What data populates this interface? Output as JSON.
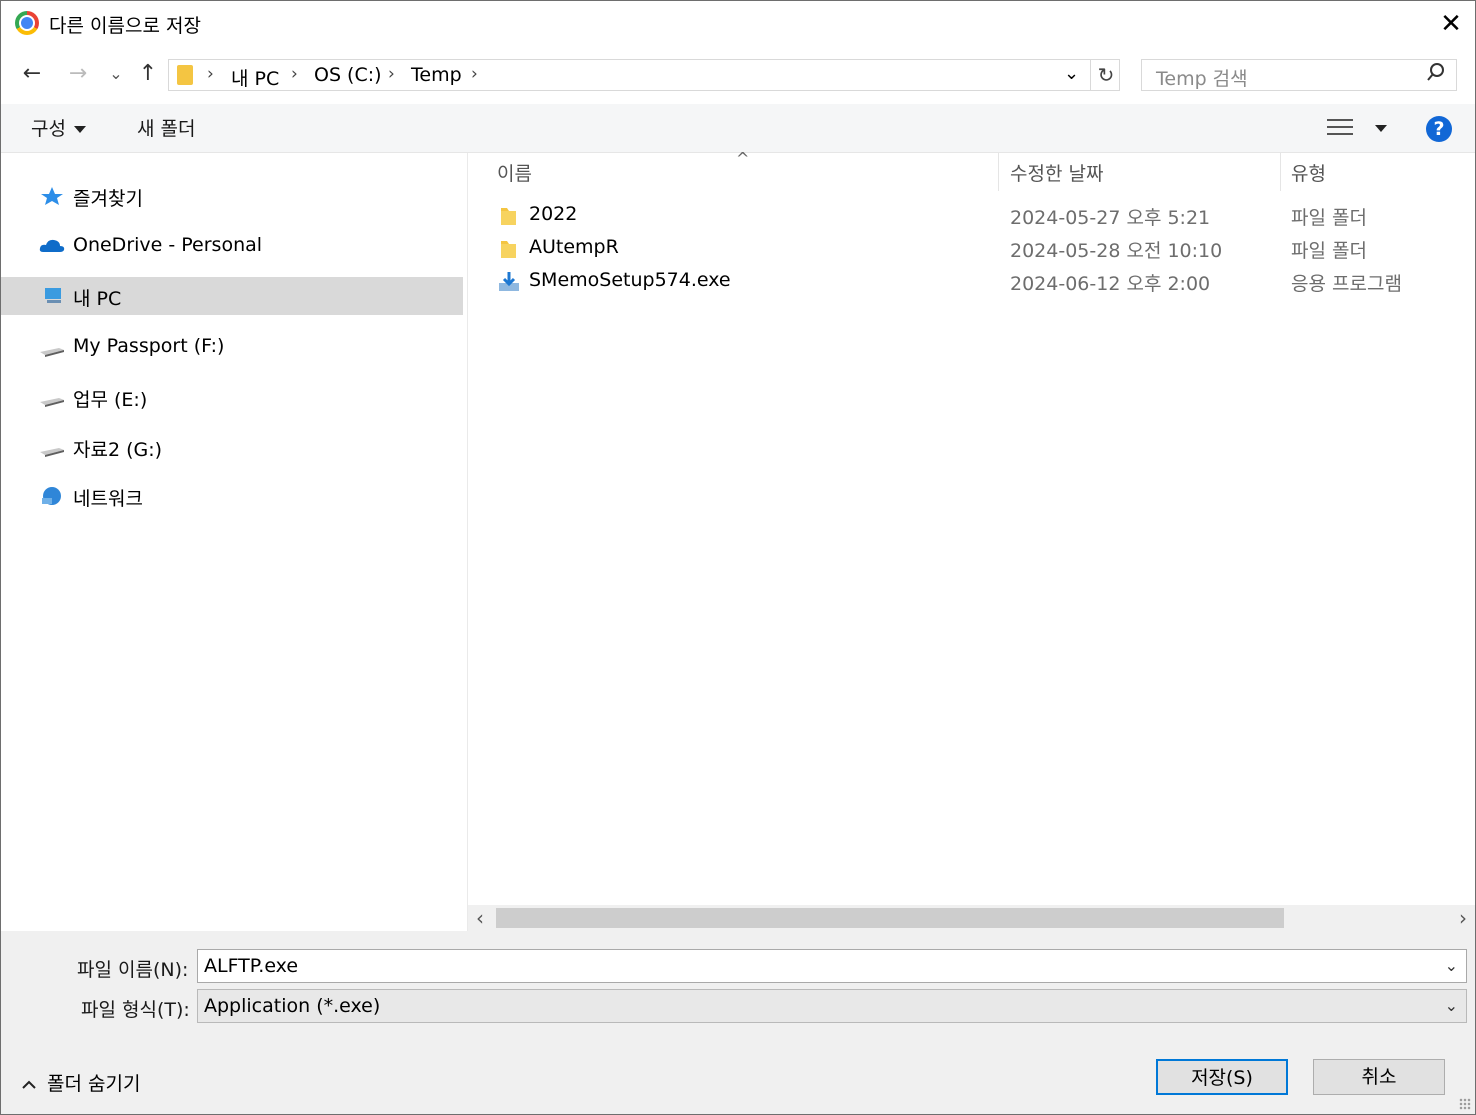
{
  "window": {
    "title": "다른 이름으로 저장",
    "close": "✕"
  },
  "nav": {
    "back": "←",
    "forward": "→",
    "recent": "⌄",
    "up": "↑",
    "breadcrumbs": [
      "내 PC",
      "OS (C:)",
      "Temp"
    ],
    "separator": "›",
    "dropdown": "⌄",
    "refresh": "↻",
    "search_placeholder": "Temp 검색"
  },
  "toolbar": {
    "organize": "구성",
    "new_folder": "새 폴더",
    "help": "?"
  },
  "sidebar": {
    "items": [
      {
        "label": "즐겨찾기",
        "icon": "star-icon",
        "selected": false
      },
      {
        "label": "OneDrive - Personal",
        "icon": "cloud-icon",
        "selected": false
      },
      {
        "label": "내 PC",
        "icon": "computer-icon",
        "selected": true
      },
      {
        "label": "My Passport (F:)",
        "icon": "drive-icon",
        "selected": false
      },
      {
        "label": "업무 (E:)",
        "icon": "drive-icon",
        "selected": false
      },
      {
        "label": "자료2 (G:)",
        "icon": "drive-icon",
        "selected": false
      },
      {
        "label": "네트워크",
        "icon": "network-icon",
        "selected": false
      }
    ]
  },
  "files": {
    "columns": {
      "name": "이름",
      "date": "수정한 날짜",
      "type": "유형"
    },
    "sort_indicator": "^",
    "rows": [
      {
        "name": "2022",
        "date": "2024-05-27 오후 5:21",
        "type": "파일 폴더",
        "icon": "folder-icon"
      },
      {
        "name": "AUtempR",
        "date": "2024-05-28 오전 10:10",
        "type": "파일 폴더",
        "icon": "folder-icon"
      },
      {
        "name": "SMemoSetup574.exe",
        "date": "2024-06-12 오후 2:00",
        "type": "응용 프로그램",
        "icon": "installer-icon"
      }
    ]
  },
  "scroll": {
    "left": "‹",
    "right": "›"
  },
  "form": {
    "filename_label": "파일 이름(N):",
    "filename_value": "ALFTP.exe",
    "filetype_label": "파일 형식(T):",
    "filetype_value": "Application (*.exe)",
    "dropdown": "⌄"
  },
  "footer": {
    "hide_folders": "폴더 숨기기",
    "save": "저장(S)",
    "cancel": "취소"
  },
  "colors": {
    "accent": "#0078d7",
    "help": "#1167d6",
    "folder": "#f4c542",
    "selection": "#d9d9d9"
  }
}
